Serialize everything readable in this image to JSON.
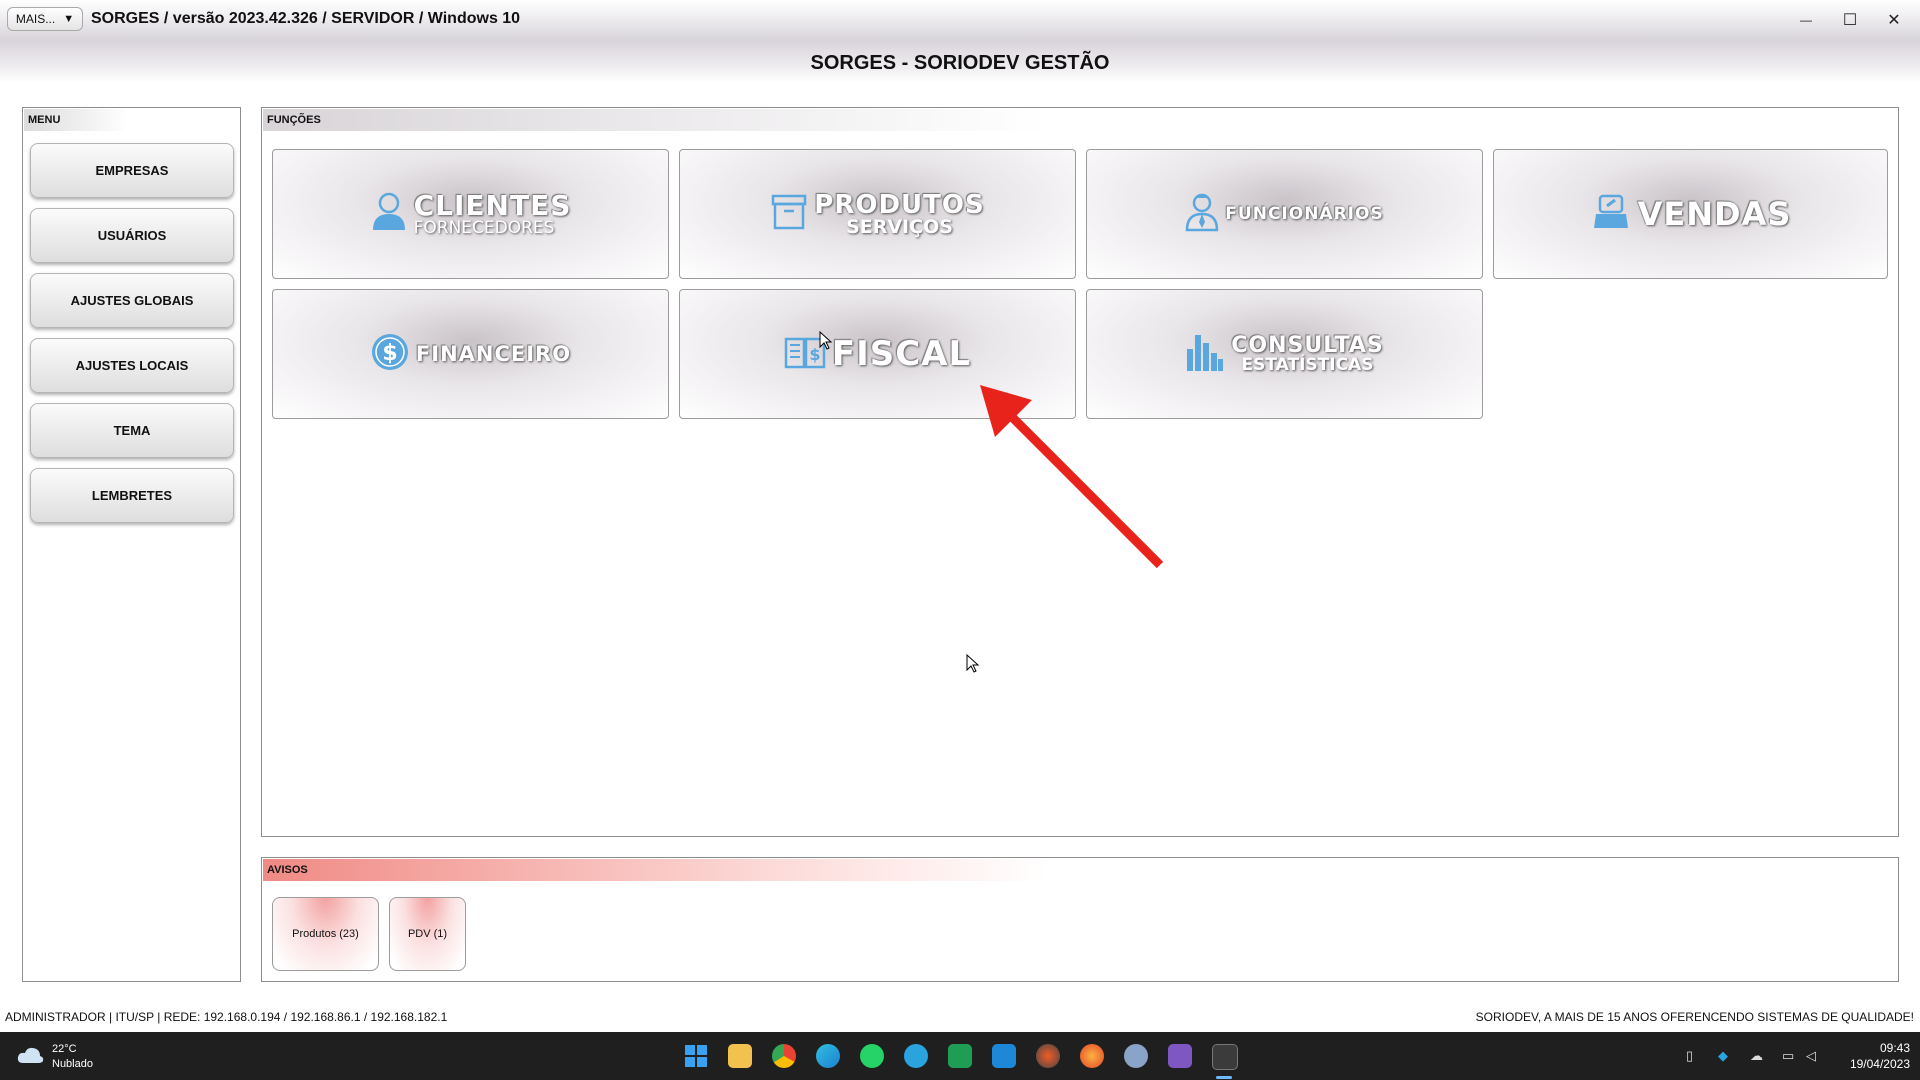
{
  "titlebar": {
    "mais_label": "MAIS...",
    "mais_arrow": "▼",
    "title": "SORGES / versão 2023.42.326 / SERVIDOR / Windows 10",
    "minimize": "—",
    "maximize": "☐",
    "close": "✕"
  },
  "header": {
    "title": "SORGES - SORIODEV GESTÃO"
  },
  "menu": {
    "heading": "MENU",
    "items": [
      {
        "label": "EMPRESAS"
      },
      {
        "label": "USUÁRIOS"
      },
      {
        "label": "AJUSTES GLOBAIS"
      },
      {
        "label": "AJUSTES LOCAIS"
      },
      {
        "label": "TEMA"
      },
      {
        "label": "LEMBRETES"
      }
    ]
  },
  "funcoes": {
    "heading": "FUNÇÕES",
    "tiles": {
      "clientes": {
        "title": "CLIENTES",
        "subtitle": "FORNECEDORES",
        "icon": "person-icon"
      },
      "produtos": {
        "title": "PRODUTOS",
        "subtitle": "SERVIÇOS",
        "icon": "box-icon"
      },
      "funcionarios": {
        "title": "FUNCIONÁRIOS",
        "icon": "employee-icon"
      },
      "vendas": {
        "title": "VENDAS",
        "icon": "cash-register-icon"
      },
      "financeiro": {
        "title": "FINANCEIRO",
        "icon": "dollar-coin-icon"
      },
      "fiscal": {
        "title": "FISCAL",
        "icon": "fiscal-book-icon"
      },
      "consultas": {
        "title": "CONSULTAS",
        "subtitle": "ESTATÍSTICAS",
        "icon": "bar-chart-icon"
      }
    }
  },
  "avisos": {
    "heading": "AVISOS",
    "items": [
      {
        "label": "Produtos (23)"
      },
      {
        "label": "PDV (1)"
      }
    ]
  },
  "statusbar": {
    "left": "ADMINISTRADOR |   ITU/SP |   REDE: 192.168.0.194 / 192.168.86.1 / 192.168.182.1",
    "right": "SORIODEV, A MAIS DE 15 ANOS OFERENCENDO SISTEMAS DE QUALIDADE!"
  },
  "taskbar": {
    "weather_temp": "22°C",
    "weather_desc": "Nublado",
    "time": "09:43",
    "date": "19/04/2023"
  },
  "colors": {
    "accent_blue": "#5aa7e0",
    "avisos_red": "#f08a84",
    "annotation_arrow": "#e8231c",
    "taskbar_bg": "#1f1f1f"
  }
}
